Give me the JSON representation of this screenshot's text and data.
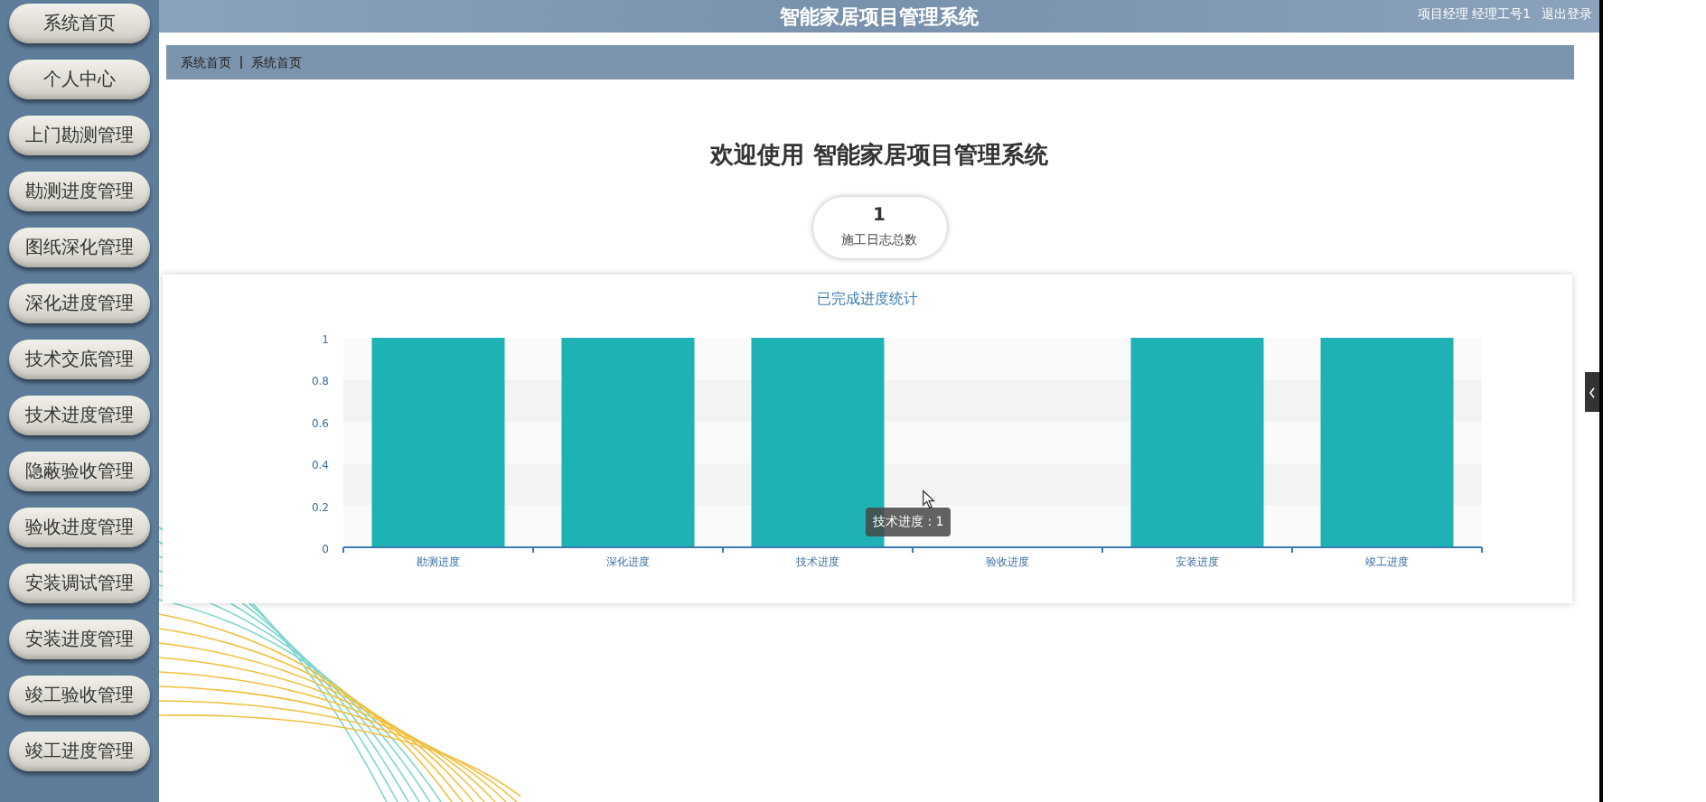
{
  "sidebar": {
    "items": [
      {
        "label": "系统首页",
        "selected": false
      },
      {
        "label": "个人中心",
        "selected": false
      },
      {
        "label": "上门勘测管理",
        "selected": false
      },
      {
        "label": "勘测进度管理",
        "selected": false
      },
      {
        "label": "图纸深化管理",
        "selected": false
      },
      {
        "label": "深化进度管理",
        "selected": false
      },
      {
        "label": "技术交底管理",
        "selected": false
      },
      {
        "label": "技术进度管理",
        "selected": false
      },
      {
        "label": "隐蔽验收管理",
        "selected": false
      },
      {
        "label": "验收进度管理",
        "selected": false
      },
      {
        "label": "安装调试管理",
        "selected": false
      },
      {
        "label": "安装进度管理",
        "selected": false
      },
      {
        "label": "竣工验收管理",
        "selected": false
      },
      {
        "label": "竣工进度管理",
        "selected": false
      }
    ]
  },
  "header": {
    "title": "智能家居项目管理系统",
    "user_links": [
      "项目经理 经理工号1",
      "退出登录"
    ]
  },
  "breadcrumb": [
    "系统首页",
    "系统首页"
  ],
  "welcome": {
    "prefix": "欢迎使用",
    "name": "智能家居项目管理系统"
  },
  "stat": {
    "value": "1",
    "label": "施工日志总数"
  },
  "chart": {
    "tooltip": "技术进度 : 1",
    "chart_data": {
      "type": "bar",
      "title": "已完成进度统计",
      "categories": [
        "勘测进度",
        "深化进度",
        "技术进度",
        "验收进度",
        "安装进度",
        "竣工进度"
      ],
      "series": [
        {
          "color": "#1fb2b4",
          "values": [
            1,
            1,
            1,
            0,
            1,
            1
          ]
        }
      ],
      "ylim": [
        0,
        1
      ],
      "yticks": [
        0,
        0.2,
        0.4,
        0.6,
        0.8,
        1
      ]
    }
  }
}
